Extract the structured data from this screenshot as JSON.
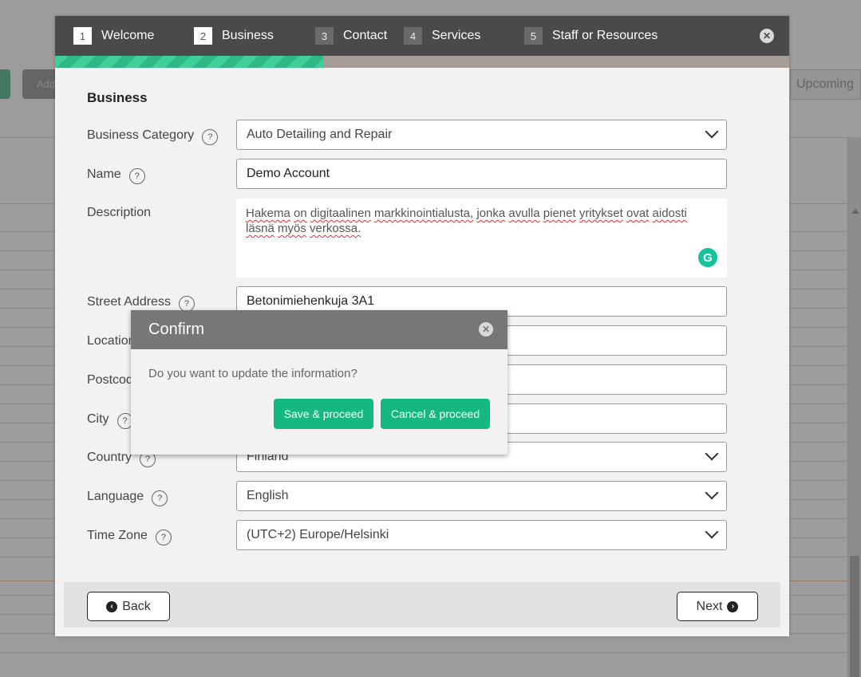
{
  "background": {
    "add_button_label": "Add",
    "upcoming_tab": "Upcoming"
  },
  "wizard": {
    "steps": [
      {
        "num": "1",
        "label": "Welcome"
      },
      {
        "num": "2",
        "label": "Business"
      },
      {
        "num": "3",
        "label": "Contact"
      },
      {
        "num": "4",
        "label": "Services"
      },
      {
        "num": "5",
        "label": "Staff or Resources"
      }
    ],
    "progress_fraction": 0.365,
    "section_title": "Business",
    "fields": {
      "category_label": "Business Category",
      "category_value": "Auto Detailing and Repair",
      "name_label": "Name",
      "name_value": "Demo Account",
      "description_label": "Description",
      "description_words": [
        "Hakema",
        "on",
        "digitaalinen",
        "markkinointialusta,",
        "jonka",
        "avulla",
        "pienet",
        "yritykset",
        "ovat",
        "aidosti",
        "läsnä",
        "myös",
        "verkossa."
      ],
      "street_label": "Street Address",
      "street_value": "Betonimiehenkuja 3A1",
      "location_label": "Location",
      "postcode_label": "Postcode",
      "city_label": "City",
      "country_label": "Country",
      "country_value": "Finland",
      "language_label": "Language",
      "language_value": "English",
      "timezone_label": "Time Zone",
      "timezone_value": "(UTC+2) Europe/Helsinki"
    },
    "back_label": "Back",
    "next_label": "Next"
  },
  "confirm": {
    "title": "Confirm",
    "message": "Do you want to update the information?",
    "save_label": "Save & proceed",
    "cancel_label": "Cancel & proceed"
  },
  "icons": {
    "close": "close-icon",
    "help": "help-icon",
    "chevron": "chevron-down-icon",
    "grammarly": "grammarly-icon",
    "back_arrow": "arrow-left-circle-icon",
    "next_arrow": "arrow-right-circle-icon"
  },
  "colors": {
    "header_bg": "#4a4a4a",
    "accent_green": "#15b880",
    "confirm_header": "#777777"
  }
}
